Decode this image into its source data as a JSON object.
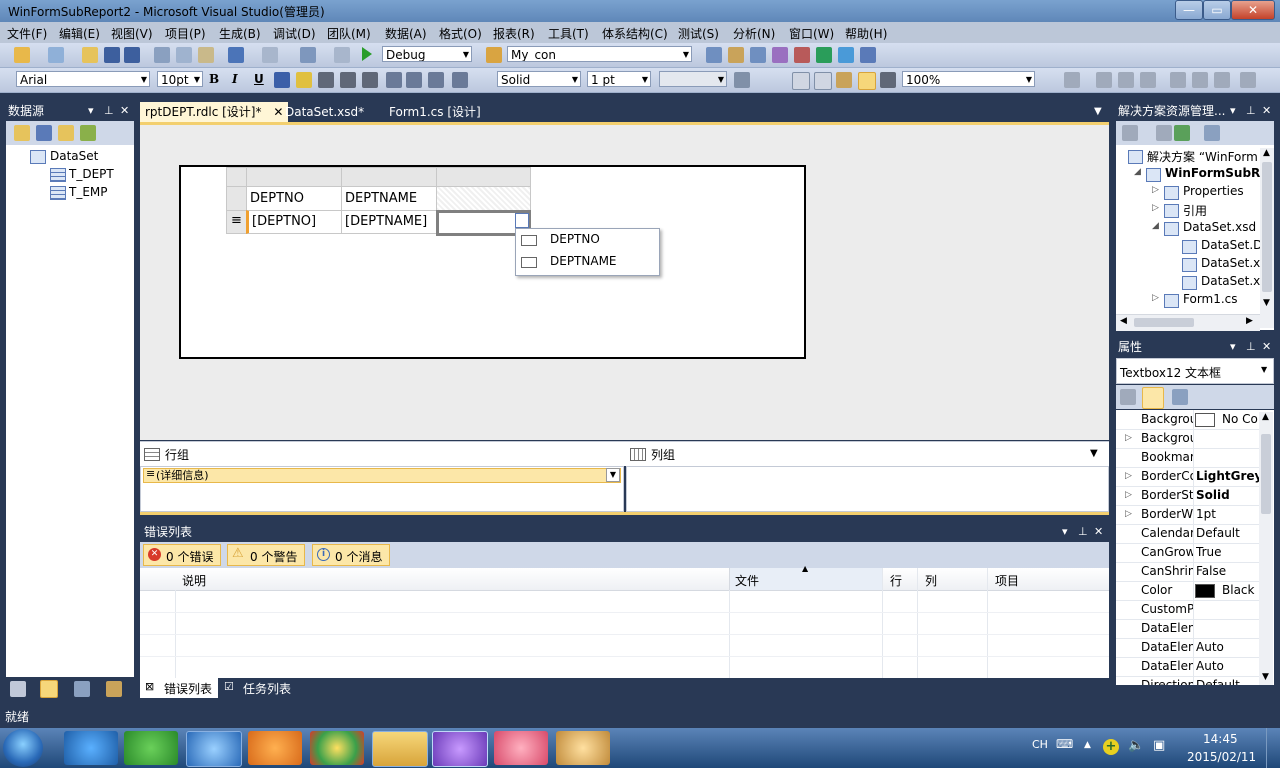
{
  "window": {
    "title": "WinFormSubReport2 - Microsoft Visual Studio(管理员)",
    "min": "—",
    "max": "▭",
    "close": "✕"
  },
  "menu": [
    "文件(F)",
    "编辑(E)",
    "视图(V)",
    "项目(P)",
    "生成(B)",
    "调试(D)",
    "团队(M)",
    "数据(A)",
    "格式(O)",
    "报表(R)",
    "工具(T)",
    "体系结构(C)",
    "测试(S)",
    "分析(N)",
    "窗口(W)",
    "帮助(H)"
  ],
  "toolbar1": {
    "config": "Debug",
    "connection": "My_con"
  },
  "toolbar2": {
    "font": "Arial",
    "size": "10pt",
    "bold": "B",
    "italic": "I",
    "underline": "U",
    "border_style": "Solid",
    "border_width": "1 pt",
    "zoom": "100%"
  },
  "datasource": {
    "title": "数据源",
    "root": "DataSet",
    "tables": [
      "T_DEPT",
      "T_EMP"
    ]
  },
  "tabs": [
    {
      "label": "rptDEPT.rdlc [设计]*",
      "active": true
    },
    {
      "label": "DataSet.xsd*"
    },
    {
      "label": "Form1.cs [设计]"
    }
  ],
  "report": {
    "header_cols": [
      "DEPTNO",
      "DEPTNAME",
      ""
    ],
    "data_cols": [
      "[DEPTNO]",
      "[DEPTNAME]",
      ""
    ],
    "row_handle": "≡",
    "dropdown_fields": [
      "DEPTNO",
      "DEPTNAME"
    ]
  },
  "groups": {
    "row_title": "行组",
    "col_title": "列组",
    "detail": "(详细信息)",
    "detail_mark": "≡"
  },
  "errors": {
    "title": "错误列表",
    "errors_btn": "0 个错误",
    "warnings_btn": "0 个警告",
    "messages_btn": "0 个消息",
    "columns": [
      "说明",
      "文件",
      "行",
      "列",
      "项目"
    ],
    "bottom_tabs": [
      "错误列表",
      "任务列表"
    ]
  },
  "solution": {
    "title": "解决方案资源管理...",
    "items": [
      {
        "label": "解决方案 “WinForm",
        "indent": 0,
        "expander": ""
      },
      {
        "label": "WinFormSubRe",
        "indent": 1,
        "expander": "◢",
        "bold": true
      },
      {
        "label": "Properties",
        "indent": 2,
        "expander": "▷"
      },
      {
        "label": "引用",
        "indent": 2,
        "expander": "▷"
      },
      {
        "label": "DataSet.xsd",
        "indent": 2,
        "expander": "◢"
      },
      {
        "label": "DataSet.D",
        "indent": 3,
        "expander": ""
      },
      {
        "label": "DataSet.x",
        "indent": 3,
        "expander": ""
      },
      {
        "label": "DataSet.x",
        "indent": 3,
        "expander": ""
      },
      {
        "label": "Form1.cs",
        "indent": 2,
        "expander": "▷"
      }
    ]
  },
  "properties": {
    "title": "属性",
    "object": "Textbox12 文本框",
    "rows": [
      {
        "name": "Backgrou",
        "value": "No Co",
        "swatch": "#ffffff",
        "exp": ""
      },
      {
        "name": "Backgrou",
        "value": "",
        "exp": "▷"
      },
      {
        "name": "Bookmar",
        "value": "",
        "exp": ""
      },
      {
        "name": "BorderCo",
        "value": "LightGrey",
        "exp": "▷",
        "bold": true
      },
      {
        "name": "BorderSt",
        "value": "Solid",
        "exp": "▷",
        "bold": true
      },
      {
        "name": "BorderW",
        "value": "1pt",
        "exp": "▷"
      },
      {
        "name": "Calendar",
        "value": "Default",
        "exp": ""
      },
      {
        "name": "CanGrow",
        "value": "True",
        "exp": ""
      },
      {
        "name": "CanShrin",
        "value": "False",
        "exp": ""
      },
      {
        "name": "Color",
        "value": "Black",
        "swatch": "#000000",
        "exp": ""
      },
      {
        "name": "CustomP",
        "value": "",
        "exp": ""
      },
      {
        "name": "DataElen",
        "value": "",
        "exp": ""
      },
      {
        "name": "DataElen",
        "value": "Auto",
        "exp": ""
      },
      {
        "name": "DataElen",
        "value": "Auto",
        "exp": ""
      },
      {
        "name": "Direction",
        "value": "Default",
        "exp": ""
      }
    ]
  },
  "status": "就绪",
  "clock": {
    "time": "14:45",
    "date": "2015/02/11",
    "lang": "CH"
  }
}
